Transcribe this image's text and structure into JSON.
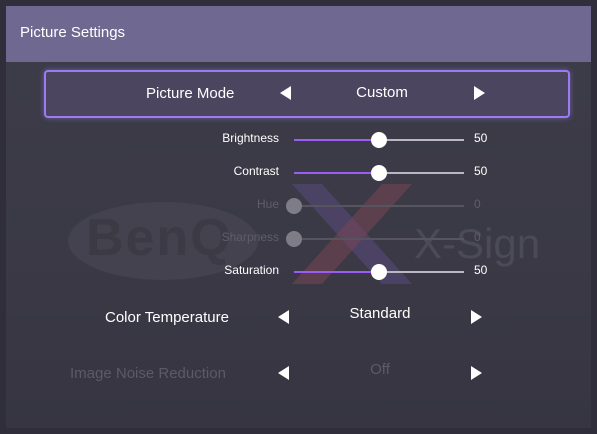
{
  "header": {
    "title": "Picture Settings"
  },
  "watermark": {
    "brand": "BenQ",
    "product": "X-Sign"
  },
  "picture_mode": {
    "label": "Picture Mode",
    "value": "Custom"
  },
  "sliders": [
    {
      "label": "Brightness",
      "value": "50",
      "level": 0.5,
      "enabled": true
    },
    {
      "label": "Contrast",
      "value": "50",
      "level": 0.5,
      "enabled": true
    },
    {
      "label": "Hue",
      "value": "0",
      "level": 0,
      "enabled": false
    },
    {
      "label": "Sharpness",
      "value": "0",
      "level": 0,
      "enabled": false
    },
    {
      "label": "Saturation",
      "value": "50",
      "level": 0.5,
      "enabled": true
    }
  ],
  "color_temperature": {
    "label": "Color Temperature",
    "value": "Standard"
  },
  "noise_reduction": {
    "label": "Image Noise Reduction",
    "value": "Off"
  },
  "colors": {
    "accent": "#9b5cf5",
    "header_bg": "#6f6891",
    "focus_border": "#9a7cf0"
  },
  "icons": {
    "decrease": "arrow-left-icon",
    "increase": "arrow-right-icon"
  }
}
